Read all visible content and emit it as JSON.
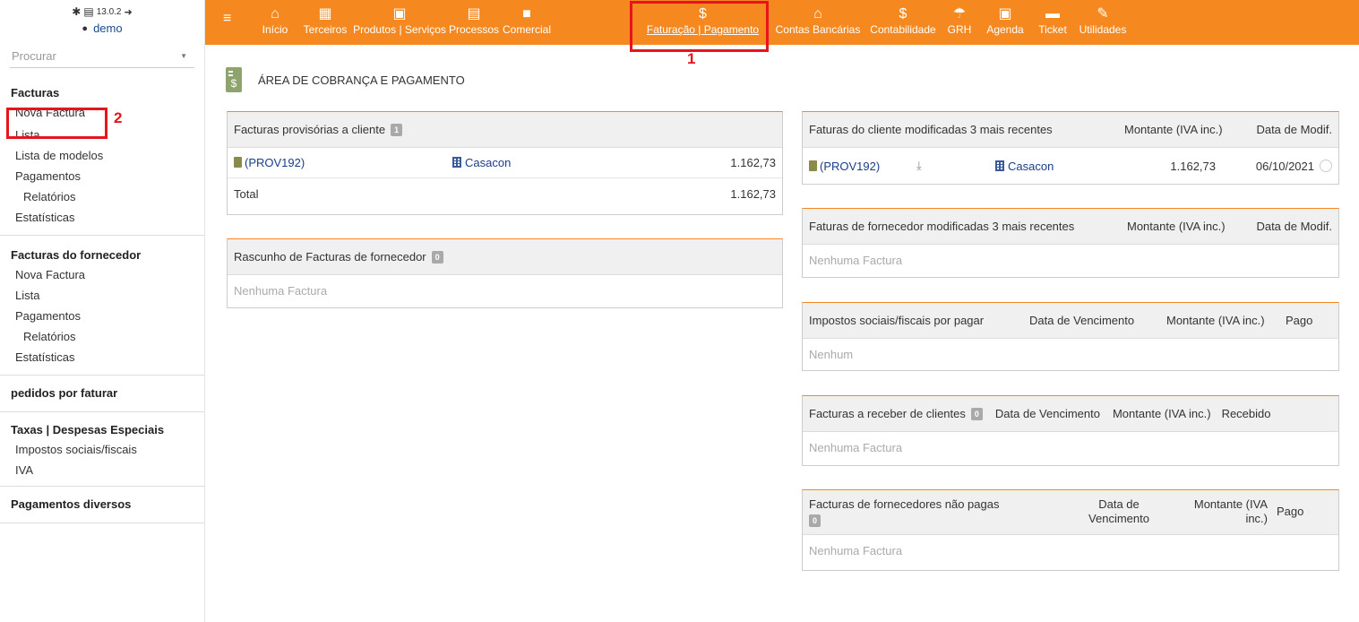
{
  "sidebar": {
    "version": "13.0.2",
    "user": "demo",
    "search_placeholder": "Procurar",
    "blocks": [
      {
        "title": "Facturas",
        "items": [
          "Nova Factura",
          "Lista",
          "Lista de modelos",
          "Pagamentos",
          "Relatórios",
          "Estatísticas"
        ]
      },
      {
        "title": "Facturas do fornecedor",
        "items": [
          "Nova Factura",
          "Lista",
          "Pagamentos",
          "Relatórios",
          "Estatísticas"
        ]
      },
      {
        "title": "pedidos por faturar"
      },
      {
        "title": "Taxas | Despesas Especiais",
        "items": [
          "Impostos sociais/fiscais",
          "IVA"
        ]
      },
      {
        "title": "Pagamentos diversos"
      }
    ]
  },
  "topbar": {
    "items": [
      {
        "label": "Início",
        "icon": "home-icon"
      },
      {
        "label": "Terceiros",
        "icon": "building-icon"
      },
      {
        "label": "Produtos | Serviços",
        "icon": "box-icon"
      },
      {
        "label": "Processos",
        "icon": "clipboard-icon"
      },
      {
        "label": "Comercial",
        "icon": "briefcase-icon"
      },
      {
        "label": "Faturação | Pagamento",
        "icon": "dollar-icon"
      },
      {
        "label": "Contas Bancárias",
        "icon": "bank-icon"
      },
      {
        "label": "Contabilidade",
        "icon": "dollar-icon"
      },
      {
        "label": "GRH",
        "icon": "umbrella-icon"
      },
      {
        "label": "Agenda",
        "icon": "calendar-icon"
      },
      {
        "label": "Ticket",
        "icon": "ticket-icon"
      },
      {
        "label": "Utilidades",
        "icon": "wrench-icon"
      }
    ]
  },
  "annotations": {
    "one": "1",
    "two": "2"
  },
  "page": {
    "title": "ÁREA DE COBRANÇA E PAGAMENTO"
  },
  "panels": {
    "prov": {
      "title": "Facturas provisórias a cliente",
      "badge": "1",
      "ref": "(PROV192)",
      "company": "Casacon",
      "amount": "1.162,73",
      "total_label": "Total",
      "total": "1.162,73"
    },
    "rascunho": {
      "title": "Rascunho de Facturas de fornecedor",
      "badge": "0",
      "empty": "Nenhuma Factura"
    },
    "recent_cli": {
      "title": "Faturas do cliente modificadas 3 mais recentes",
      "col1": "Montante (IVA inc.)",
      "col2": "Data de Modif.",
      "ref": "(PROV192)",
      "company": "Casacon",
      "amount": "1.162,73",
      "date": "06/10/2021"
    },
    "recent_forn": {
      "title": "Faturas de fornecedor modificadas 3 mais recentes",
      "col1": "Montante (IVA inc.)",
      "col2": "Data de Modif.",
      "empty": "Nenhuma Factura"
    },
    "impostos": {
      "title": "Impostos sociais/fiscais por pagar",
      "col1": "Data de Vencimento",
      "col2": "Montante (IVA inc.)",
      "col3": "Pago",
      "empty": "Nenhum"
    },
    "receber": {
      "title": "Facturas a receber de clientes",
      "badge": "0",
      "col1": "Data de Vencimento",
      "col2": "Montante (IVA inc.)",
      "col3": "Recebido",
      "empty": "Nenhuma Factura"
    },
    "naopagas": {
      "title": "Facturas de fornecedores não pagas",
      "badge": "0",
      "col1a": "Data de",
      "col1b": "Vencimento",
      "col2a": "Montante (IVA",
      "col2b": "inc.)",
      "col3": "Pago",
      "empty": "Nenhuma Factura"
    }
  }
}
